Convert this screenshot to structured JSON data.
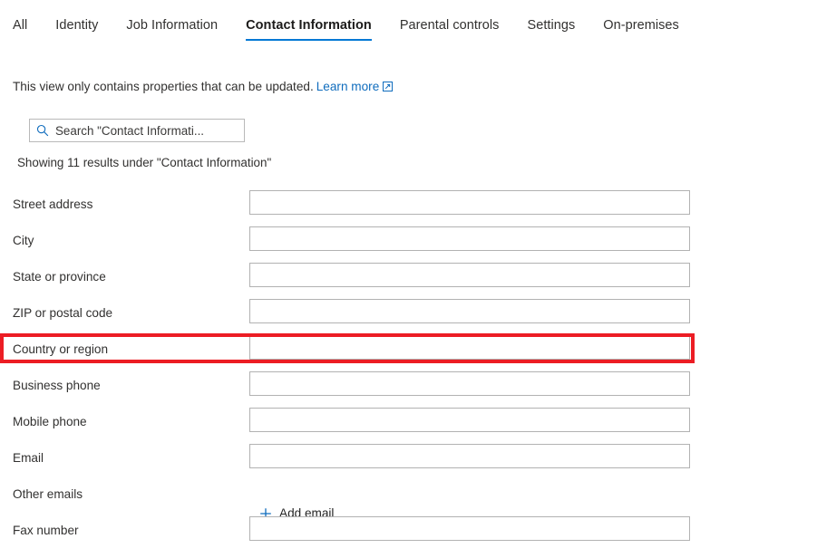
{
  "tabs": [
    {
      "label": "All",
      "active": false
    },
    {
      "label": "Identity",
      "active": false
    },
    {
      "label": "Job Information",
      "active": false
    },
    {
      "label": "Contact Information",
      "active": true
    },
    {
      "label": "Parental controls",
      "active": false
    },
    {
      "label": "Settings",
      "active": false
    },
    {
      "label": "On-premises",
      "active": false
    }
  ],
  "info": {
    "text": "This view only contains properties that can be updated.",
    "link_label": "Learn more",
    "link_icon": "external-link-icon"
  },
  "search": {
    "icon": "search-icon",
    "placeholder": "Search \"Contact Informati...",
    "value": ""
  },
  "results": {
    "text": "Showing 11 results under \"Contact Information\""
  },
  "form": {
    "rows": [
      {
        "label": "Street address",
        "value": "",
        "type": "input",
        "highlighted": false
      },
      {
        "label": "City",
        "value": "",
        "type": "input",
        "highlighted": false
      },
      {
        "label": "State or province",
        "value": "",
        "type": "input",
        "highlighted": false
      },
      {
        "label": "ZIP or postal code",
        "value": "",
        "type": "input",
        "highlighted": false
      },
      {
        "label": "Country or region",
        "value": "",
        "type": "input",
        "highlighted": true
      },
      {
        "label": "Business phone",
        "value": "",
        "type": "input",
        "highlighted": false
      },
      {
        "label": "Mobile phone",
        "value": "",
        "type": "input",
        "highlighted": false
      },
      {
        "label": "Email",
        "value": "",
        "type": "input",
        "highlighted": false
      },
      {
        "label": "Other emails",
        "value": "",
        "type": "action",
        "action_label": "Add email",
        "action_icon": "plus-icon",
        "highlighted": false
      },
      {
        "label": "Fax number",
        "value": "",
        "type": "input",
        "highlighted": false
      }
    ]
  },
  "colors": {
    "accent": "#0078d4",
    "link": "#0f6cbd",
    "highlight": "#ec1d24",
    "text": "#323130",
    "field_border": "#b2b2b2"
  }
}
